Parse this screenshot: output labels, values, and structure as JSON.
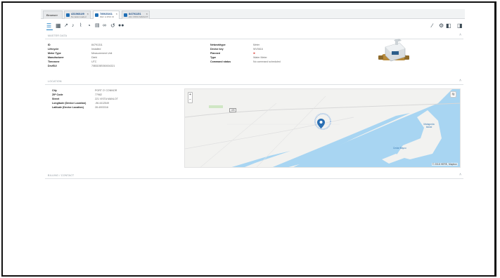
{
  "tabs": {
    "browser_label": "Browser",
    "items": [
      {
        "id": "4319664/9",
        "sub": "No tasks loaded"
      },
      {
        "id": "78915161",
        "sub": "REF & MSN ID"
      },
      {
        "id": "84791151",
        "sub": "221 VISTA MANLOT"
      }
    ]
  },
  "toolbar": {
    "icons": [
      "list-icon",
      "table-icon",
      "chart-icon",
      "bell-icon",
      "paperclip-icon",
      "pie-icon",
      "clipboard-icon",
      "link-icon",
      "history-icon",
      "users-icon"
    ],
    "right_icons": [
      "edit-icon",
      "tools-icon",
      "key-icon",
      "bookmark-icon"
    ]
  },
  "master_data": {
    "title": "MASTER DATA",
    "left": [
      {
        "k": "ID",
        "v": "84791311"
      },
      {
        "k": "Lifecycle",
        "v": "Installed"
      },
      {
        "k": "Meter Type",
        "v": "Measurement Unit"
      },
      {
        "k": "Manufacturer",
        "v": "Diehl"
      },
      {
        "k": "Timezone",
        "v": "UTC"
      },
      {
        "k": "DevEUI",
        "v": "70B3D5E050004321"
      }
    ],
    "right": [
      {
        "k": "Networktype",
        "v": "Meter"
      },
      {
        "k": "Device key",
        "v": "WV0616"
      },
      {
        "k": "Planned",
        "v": "✖"
      },
      {
        "k": "Type",
        "v": "Water Meter"
      },
      {
        "k": "Command status",
        "v": "No command scheduled"
      }
    ]
  },
  "location": {
    "title": "LOCATION",
    "fields": [
      {
        "k": "City",
        "v": "PORT O' CONNOR"
      },
      {
        "k": "ZIP Code",
        "v": "77982"
      },
      {
        "k": "Street",
        "v": "221 VISTA MANLOT"
      },
      {
        "k": "Longitude (Device Location)",
        "v": "-96.4412549"
      },
      {
        "k": "Latitude (Device Location)",
        "v": "28.4003316"
      }
    ],
    "map": {
      "zoom_in": "+",
      "zoom_out": "−",
      "attribution": "© 2018 HERE, Mapbox",
      "road_label": "185",
      "island_label": "Matagorda Island",
      "island_label2": "Cedar Bayou",
      "water_color": "#a8d5f2",
      "land_color": "#f2f2f0",
      "pin_color": "#2a6fb3"
    }
  },
  "billing": {
    "title": "BILLING / CONTACT"
  }
}
